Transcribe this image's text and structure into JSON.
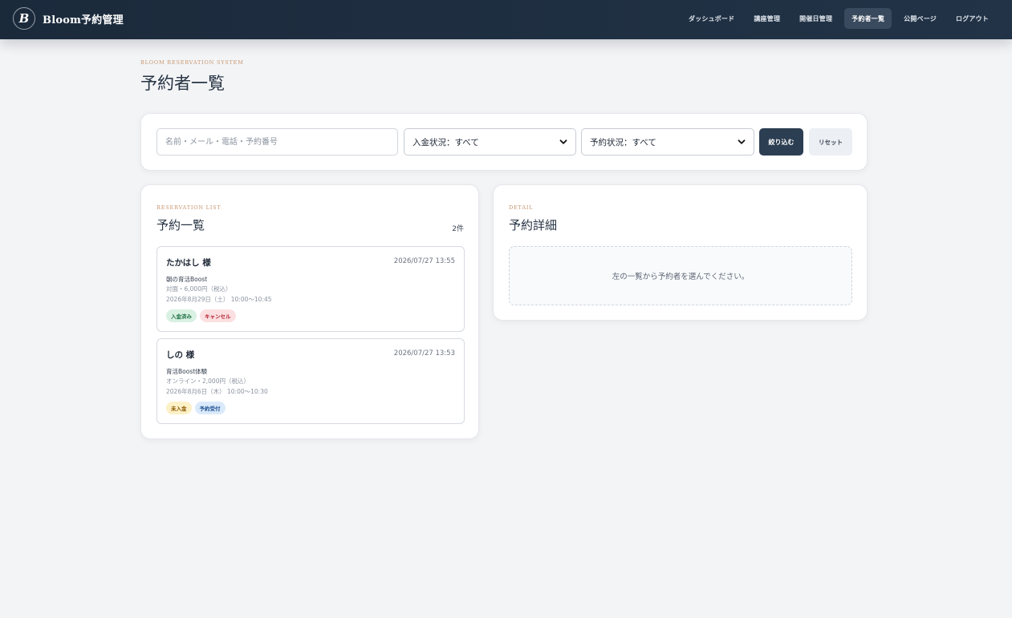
{
  "app": {
    "logo_letter": "B",
    "name": "Bloom予約管理"
  },
  "nav": {
    "items": [
      {
        "label": "ダッシュボード",
        "active": false
      },
      {
        "label": "講座管理",
        "active": false
      },
      {
        "label": "開催日管理",
        "active": false
      },
      {
        "label": "予約者一覧",
        "active": true
      },
      {
        "label": "公開ページ",
        "active": false
      },
      {
        "label": "ログアウト",
        "active": false
      }
    ]
  },
  "page": {
    "eyebrow": "BLOOM RESERVATION SYSTEM",
    "title": "予約者一覧"
  },
  "filter": {
    "search_placeholder": "名前・メール・電話・予約番号",
    "search_value": "",
    "payment_select": "入金状況：すべて",
    "status_select": "予約状況：すべて",
    "filter_button": "絞り込む",
    "reset_button": "リセット"
  },
  "list": {
    "eyebrow": "RESERVATION LIST",
    "title": "予約一覧",
    "count": "2件",
    "items": [
      {
        "name": "たかはし 様",
        "created": "2026/07/27 13:55",
        "course": "朝の育活Boost",
        "price": "対面・6,000円（税込）",
        "date": "2026年8月29日（土） 10:00〜10:45",
        "badges": [
          {
            "label": "入金済み",
            "kind": "paid"
          },
          {
            "label": "キャンセル",
            "kind": "cancel"
          }
        ]
      },
      {
        "name": "しの 様",
        "created": "2026/07/27 13:53",
        "course": "育活Boost体験",
        "price": "オンライン・2,000円（税込）",
        "date": "2026年8月6日（木） 10:00〜10:30",
        "badges": [
          {
            "label": "未入金",
            "kind": "unpaid"
          },
          {
            "label": "予約受付",
            "kind": "booked"
          }
        ]
      }
    ]
  },
  "detail": {
    "eyebrow": "DETAIL",
    "title": "予約詳細",
    "empty_message": "左の一覧から予約者を選んでください。"
  },
  "colors": {
    "header": "#1b2a3b",
    "accent_eyebrow": "#c89670",
    "primary_button": "#2c3e52",
    "background": "#f3f4f6"
  }
}
